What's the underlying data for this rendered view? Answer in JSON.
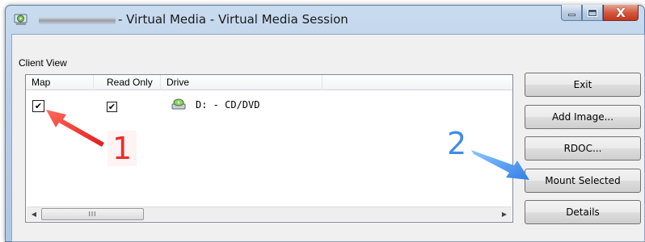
{
  "window": {
    "title": "- Virtual Media - Virtual Media Session",
    "app_icon": "virtual-media-icon",
    "controls": {
      "minimize": "minimize-icon",
      "maximize": "maximize-icon",
      "close": "close-icon",
      "close_glyph": "X"
    }
  },
  "client_view": {
    "label": "Client View",
    "columns": [
      "Map",
      "Read Only",
      "Drive"
    ],
    "rows": [
      {
        "map_checked": true,
        "read_only_checked": true,
        "drive_icon": "cd-drive-icon",
        "drive": "D: - CD/DVD"
      }
    ],
    "scrollbar": {
      "left_arrow": "◀",
      "right_arrow": "▶",
      "thumb_grip": "III"
    }
  },
  "buttons": {
    "exit": "Exit",
    "add_image": "Add Image...",
    "rdoc": "RDOC...",
    "mount_selected": "Mount Selected",
    "details": "Details"
  },
  "annotations": {
    "step1": "1",
    "step2": "2",
    "step1_color": "#ee2b2b",
    "step2_color": "#3f8de8"
  },
  "checkmark": "✔"
}
